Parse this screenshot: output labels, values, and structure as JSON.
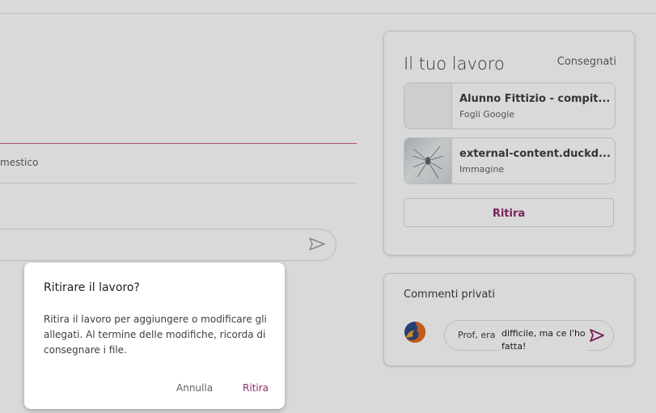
{
  "left": {
    "field_text": "mestico"
  },
  "work_card": {
    "title": "Il tuo lavoro",
    "status": "Consegnati",
    "attachments": [
      {
        "name": "Alunno Fittizio - compit...",
        "type": "Fogli Google"
      },
      {
        "name": "external-content.duckd...",
        "type": "Immagine"
      }
    ],
    "withdraw_label": "Ritira"
  },
  "comment_card": {
    "title": "Commenti privati",
    "input_text": "Prof, era",
    "overlay_text": "difficile, ma ce l'ho fatta!"
  },
  "dialog": {
    "title": "Ritirare il lavoro?",
    "body": "Ritira il lavoro per aggiungere o modificare gli allegati. Al termine delle modifiche, ricorda di consegnare i file.",
    "cancel_label": "Annulla",
    "confirm_label": "Ritira"
  },
  "colors": {
    "accent": "#8e2a6c",
    "overlay": "rgba(0,0,0,0.15)"
  },
  "icons": {
    "send": "send-icon",
    "avatar": "firefox-avatar-icon"
  }
}
